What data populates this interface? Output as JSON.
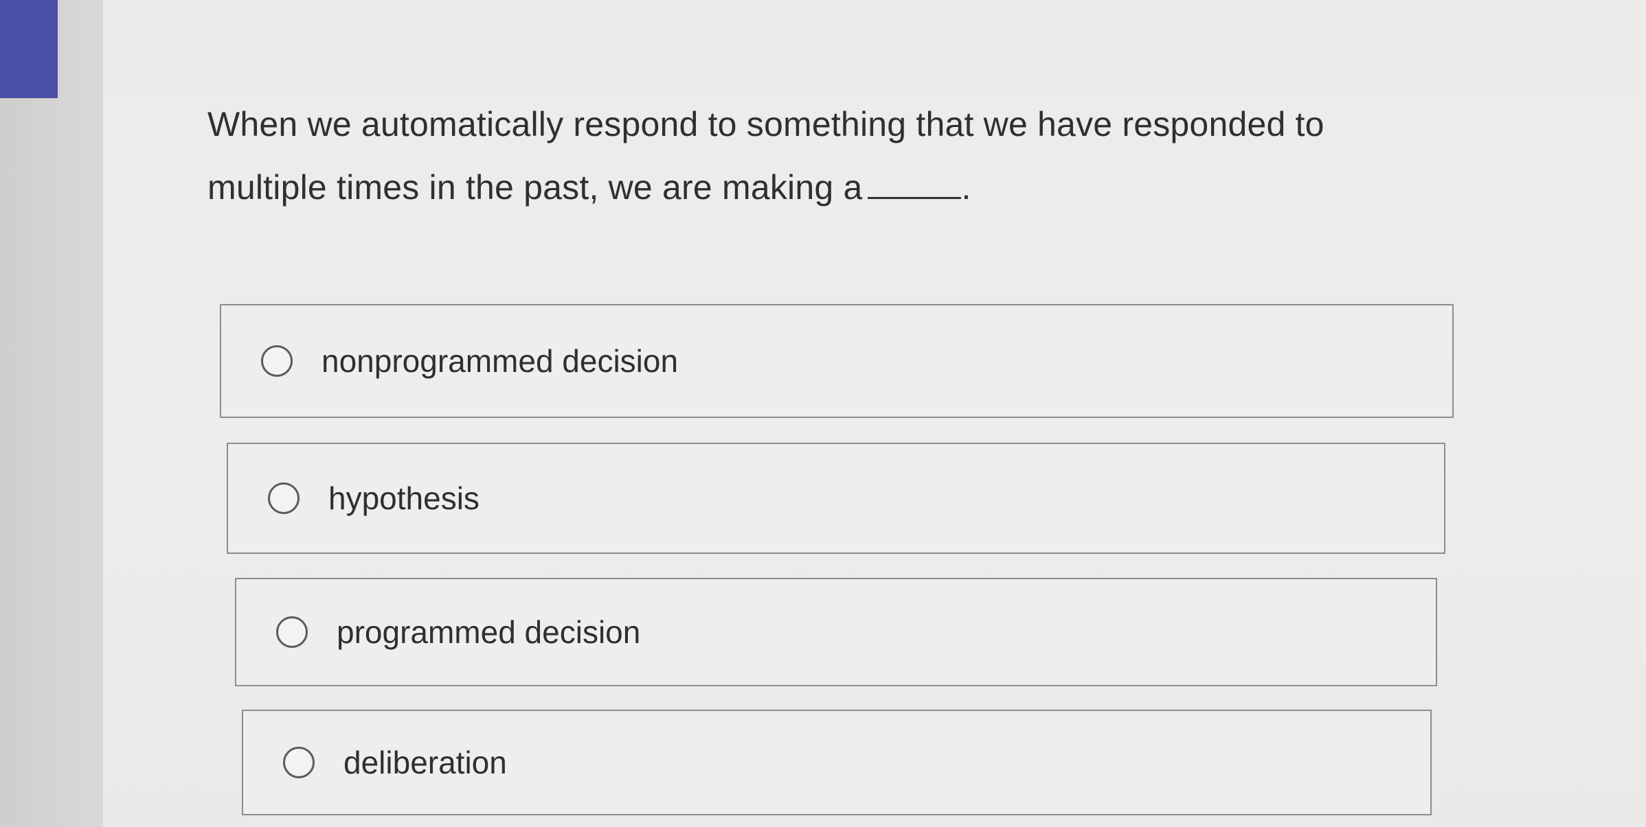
{
  "question": {
    "text": "When we automatically respond to something that we have responded to multiple times in the past, we are making a",
    "trailing_punctuation": "."
  },
  "options": [
    {
      "label": "nonprogrammed decision",
      "selected": false
    },
    {
      "label": "hypothesis",
      "selected": false
    },
    {
      "label": "programmed decision",
      "selected": false
    },
    {
      "label": "deliberation",
      "selected": false
    }
  ],
  "colors": {
    "accent": "#4a4fa6",
    "text": "#2f2f2f",
    "border": "#8d8d8b",
    "background": "#ecebe9"
  }
}
